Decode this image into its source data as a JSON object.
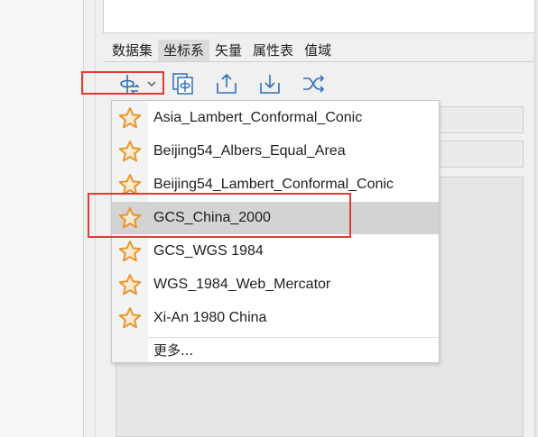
{
  "tabs": [
    {
      "label": "数据集",
      "active": false
    },
    {
      "label": "坐标系",
      "active": true
    },
    {
      "label": "矢量",
      "active": false
    },
    {
      "label": "属性表",
      "active": false
    },
    {
      "label": "值域",
      "active": false
    }
  ],
  "toolbar": {
    "icons": [
      "coordinate-system-dropdown-icon",
      "copy-coordinate-icon",
      "export-icon",
      "import-icon",
      "shuffle-convert-icon"
    ]
  },
  "menu": {
    "items": [
      {
        "label": "Asia_Lambert_Conformal_Conic",
        "selected": false
      },
      {
        "label": "Beijing54_Albers_Equal_Area",
        "selected": false
      },
      {
        "label": "Beijing54_Lambert_Conformal_Conic",
        "selected": false
      },
      {
        "label": "GCS_China_2000",
        "selected": true
      },
      {
        "label": "GCS_WGS 1984",
        "selected": false
      },
      {
        "label": "WGS_1984_Web_Mercator",
        "selected": false
      },
      {
        "label": "Xi-An 1980 China",
        "selected": false
      }
    ],
    "more_label": "更多..."
  },
  "colors": {
    "accent_red": "#e53935",
    "star_orange": "#e8952a",
    "icon_blue": "#2f6fb6"
  }
}
